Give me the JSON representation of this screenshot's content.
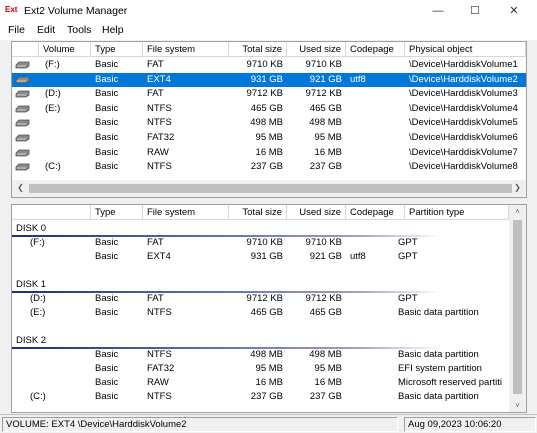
{
  "window": {
    "title": "Ext2 Volume Manager",
    "icon_text": "Ext"
  },
  "menu": [
    "File",
    "Edit",
    "Tools",
    "Help"
  ],
  "top_table": {
    "columns": [
      "Volume",
      "Type",
      "File system",
      "Total size",
      "Used size",
      "Codepage",
      "Physical object"
    ],
    "rows": [
      {
        "volume": "(F:)",
        "type": "Basic",
        "fs": "FAT",
        "total": "9710 KB",
        "used": "9710 KB",
        "codepage": "",
        "phys": "\\Device\\HarddiskVolume1"
      },
      {
        "volume": "",
        "type": "Basic",
        "fs": "EXT4",
        "total": "931 GB",
        "used": "921 GB",
        "codepage": "utf8",
        "phys": "\\Device\\HarddiskVolume2"
      },
      {
        "volume": "(D:)",
        "type": "Basic",
        "fs": "FAT",
        "total": "9712 KB",
        "used": "9712 KB",
        "codepage": "",
        "phys": "\\Device\\HarddiskVolume3"
      },
      {
        "volume": "(E:)",
        "type": "Basic",
        "fs": "NTFS",
        "total": "465 GB",
        "used": "465 GB",
        "codepage": "",
        "phys": "\\Device\\HarddiskVolume4"
      },
      {
        "volume": "",
        "type": "Basic",
        "fs": "NTFS",
        "total": "498 MB",
        "used": "498 MB",
        "codepage": "",
        "phys": "\\Device\\HarddiskVolume5"
      },
      {
        "volume": "",
        "type": "Basic",
        "fs": "FAT32",
        "total": "95 MB",
        "used": "95 MB",
        "codepage": "",
        "phys": "\\Device\\HarddiskVolume6"
      },
      {
        "volume": "",
        "type": "Basic",
        "fs": "RAW",
        "total": "16 MB",
        "used": "16 MB",
        "codepage": "",
        "phys": "\\Device\\HarddiskVolume7"
      },
      {
        "volume": "(C:)",
        "type": "Basic",
        "fs": "NTFS",
        "total": "237 GB",
        "used": "237 GB",
        "codepage": "",
        "phys": "\\Device\\HarddiskVolume8"
      }
    ],
    "selected_row": 1
  },
  "bottom_table": {
    "columns": [
      "",
      "Type",
      "File system",
      "Total size",
      "Used size",
      "Codepage",
      "Partition type"
    ],
    "disks": [
      {
        "label": "DISK 0",
        "rows": [
          {
            "volume": "(F:)",
            "type": "Basic",
            "fs": "FAT",
            "total": "9710 KB",
            "used": "9710 KB",
            "codepage": "",
            "ptype": "GPT"
          },
          {
            "volume": "",
            "type": "Basic",
            "fs": "EXT4",
            "total": "931 GB",
            "used": "921 GB",
            "codepage": "utf8",
            "ptype": "GPT"
          }
        ]
      },
      {
        "label": "DISK 1",
        "rows": [
          {
            "volume": "(D:)",
            "type": "Basic",
            "fs": "FAT",
            "total": "9712 KB",
            "used": "9712 KB",
            "codepage": "",
            "ptype": "GPT"
          },
          {
            "volume": "(E:)",
            "type": "Basic",
            "fs": "NTFS",
            "total": "465 GB",
            "used": "465 GB",
            "codepage": "",
            "ptype": "Basic data partition"
          }
        ]
      },
      {
        "label": "DISK 2",
        "rows": [
          {
            "volume": "",
            "type": "Basic",
            "fs": "NTFS",
            "total": "498 MB",
            "used": "498 MB",
            "codepage": "",
            "ptype": "Basic data partition"
          },
          {
            "volume": "",
            "type": "Basic",
            "fs": "FAT32",
            "total": "95 MB",
            "used": "95 MB",
            "codepage": "",
            "ptype": "EFI system partition"
          },
          {
            "volume": "",
            "type": "Basic",
            "fs": "RAW",
            "total": "16 MB",
            "used": "16 MB",
            "codepage": "",
            "ptype": "Microsoft reserved partiti"
          },
          {
            "volume": "(C:)",
            "type": "Basic",
            "fs": "NTFS",
            "total": "237 GB",
            "used": "237 GB",
            "codepage": "",
            "ptype": "Basic data partition"
          }
        ]
      }
    ]
  },
  "status": {
    "volume": "VOLUME:  EXT4 \\Device\\HarddiskVolume2",
    "datetime": "Aug 09,2023 10:06:20"
  },
  "colors": {
    "selection": "#0078d7",
    "disk_line": "#1c2c7c"
  }
}
